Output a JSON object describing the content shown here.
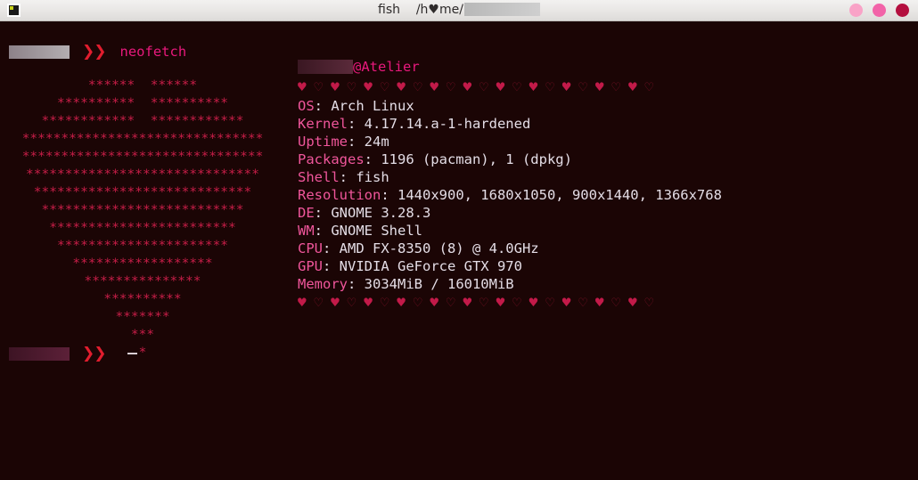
{
  "window": {
    "title_prefix": "fish",
    "title_path": "/h♥me/",
    "title_redacted": "",
    "icon": "terminal-icon",
    "buttons": {
      "minimize": "minimize",
      "maximize": "maximize",
      "close": "close"
    },
    "colors": {
      "background": "#1b0505",
      "accent_pink": "#e8197c",
      "accent_key": "#f0569b",
      "value_text": "#e4dde6",
      "ascii_art": "#c81e48",
      "heart_filled": "#c21a49",
      "heart_outline": "#7e1228",
      "chevron": "#e11d2e",
      "btn_minimize": "#f9a3c7",
      "btn_maximize": "#f263a8",
      "btn_close": "#b40f3f"
    }
  },
  "prompts": {
    "top": {
      "user_redacted": "",
      "chevrons": "❯❯",
      "command": "neofetch"
    },
    "bottom": {
      "user_redacted": "",
      "chevrons": "❯❯",
      "command": ""
    }
  },
  "ascii_art": "  ******      ******\n ##########  ##########\n############ ############\n#################################\n#################################\n################################\n ##############################\n  ############################\n   ##########################\n    ########################\n      ####################\n        ################\n          ##########\n           *******\n             ***\n              *",
  "neofetch": {
    "user_redacted": "",
    "at_host": "@Atelier",
    "separator_hearts": "♥ ♡ ♥ ♡ ♥ ♡ ♥ ♡ ♥ ♡ ♥ ♡ ♥ ♡ ♥ ♡ ♥ ♡ ♥ ♡ ♥ ♡",
    "heart_count": 22,
    "lines": [
      {
        "key": "OS",
        "sep": ": ",
        "value": "Arch Linux"
      },
      {
        "key": "Kernel",
        "sep": ": ",
        "value": "4.17.14.a-1-hardened"
      },
      {
        "key": "Uptime",
        "sep": ": ",
        "value": "24m"
      },
      {
        "key": "Packages",
        "sep": ": ",
        "value": "1196 (pacman), 1 (dpkg)"
      },
      {
        "key": "Shell",
        "sep": ": ",
        "value": "fish"
      },
      {
        "key": "Resolution",
        "sep": ": ",
        "value": "1440x900, 1680x1050, 900x1440, 1366x768"
      },
      {
        "key": "DE",
        "sep": ": ",
        "value": "GNOME 3.28.3"
      },
      {
        "key": "WM",
        "sep": ": ",
        "value": "GNOME Shell"
      },
      {
        "key": "CPU",
        "sep": ": ",
        "value": "AMD FX-8350 (8) @ 4.0GHz"
      },
      {
        "key": "GPU",
        "sep": ": ",
        "value": "NVIDIA GeForce GTX 970"
      },
      {
        "key": "Memory",
        "sep": ": ",
        "value": "3034MiB / 16010MiB"
      }
    ]
  }
}
